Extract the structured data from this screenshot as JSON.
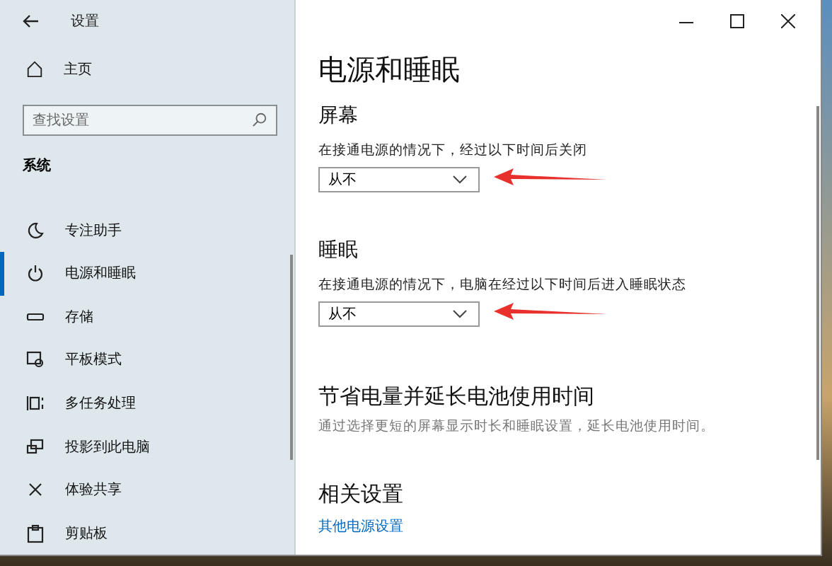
{
  "window": {
    "title": "设置"
  },
  "sidebar": {
    "home": "主页",
    "search": {
      "placeholder": "查找设置"
    },
    "section": "系统",
    "items": [
      {
        "label": "专注助手",
        "selected": false
      },
      {
        "label": "电源和睡眠",
        "selected": true
      },
      {
        "label": "存储",
        "selected": false
      },
      {
        "label": "平板模式",
        "selected": false
      },
      {
        "label": "多任务处理",
        "selected": false
      },
      {
        "label": "投影到此电脑",
        "selected": false
      },
      {
        "label": "体验共享",
        "selected": false
      },
      {
        "label": "剪贴板",
        "selected": false
      }
    ]
  },
  "page": {
    "title": "电源和睡眠",
    "sections": [
      {
        "heading": "屏幕",
        "description": "在接通电源的情况下，经过以下时间后关闭",
        "dropdown": {
          "value": "从不"
        }
      },
      {
        "heading": "睡眠",
        "description": "在接通电源的情况下，电脑在经过以下时间后进入睡眠状态",
        "dropdown": {
          "value": "从不"
        }
      }
    ],
    "battery": {
      "heading": "节省电量并延长电池使用时间",
      "description": "通过选择更短的屏幕显示时长和睡眠设置，延长电池使用时间。"
    },
    "related": {
      "heading": "相关设置",
      "link": "其他电源设置"
    }
  }
}
